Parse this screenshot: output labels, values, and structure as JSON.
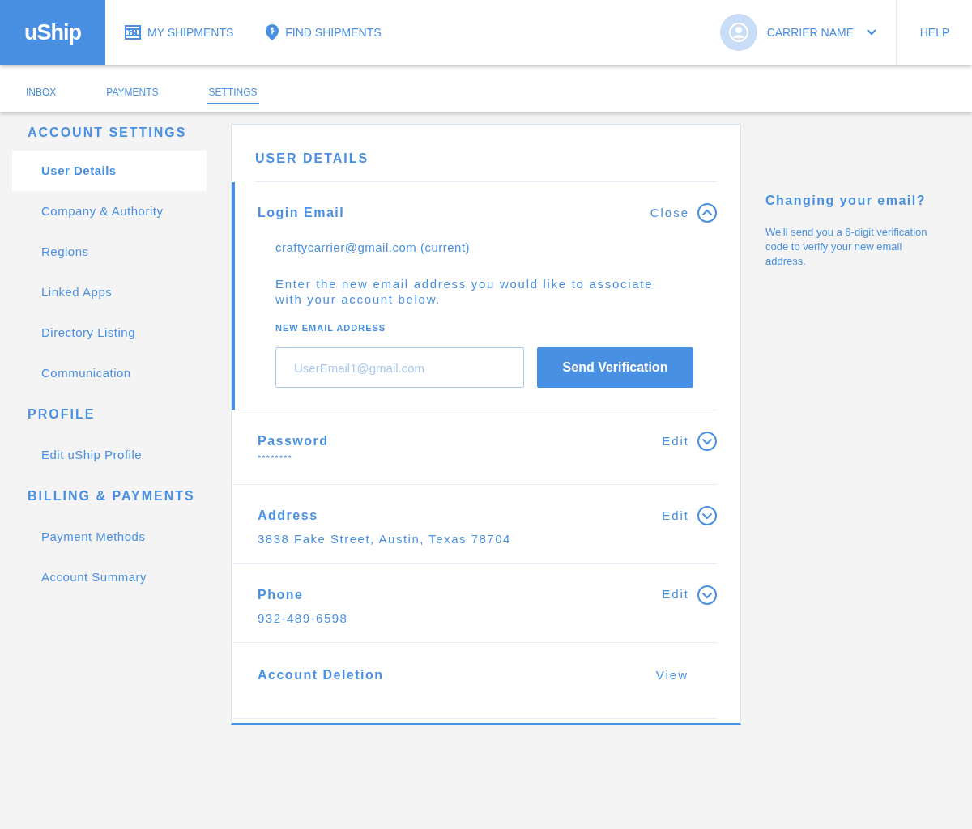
{
  "header": {
    "logo": "uShip",
    "nav": [
      {
        "label": "MY SHIPMENTS",
        "kind": "crate"
      },
      {
        "label": "FIND SHIPMENTS",
        "kind": "pin"
      }
    ],
    "user": "CARRIER NAME",
    "help": "HELP"
  },
  "subnav": [
    {
      "label": "INBOX",
      "selected": false
    },
    {
      "label": "PAYMENTS",
      "selected": false
    },
    {
      "label": "SETTINGS",
      "selected": true
    }
  ],
  "sidebar": [
    {
      "heading": "ACCOUNT SETTINGS",
      "items": [
        {
          "label": "User Details",
          "selected": true
        },
        {
          "label": "Company & Authority",
          "selected": false
        },
        {
          "label": "Regions",
          "selected": false
        },
        {
          "label": "Linked Apps",
          "selected": false
        },
        {
          "label": "Directory Listing",
          "selected": false
        },
        {
          "label": "Communication",
          "selected": false
        }
      ]
    },
    {
      "heading": "PROFILE",
      "items": [
        {
          "label": "Edit uShip Profile",
          "selected": false
        }
      ]
    },
    {
      "heading": "BILLING & PAYMENTS",
      "items": [
        {
          "label": "Payment Methods",
          "selected": false
        },
        {
          "label": "Account Summary",
          "selected": false
        }
      ]
    }
  ],
  "panel": {
    "title": "USER DETAILS",
    "sections": [
      {
        "kind": "toggle",
        "label": "Login Email",
        "action": "Close",
        "expanded": true,
        "current": "craftycarrier@gmail.com (current)",
        "instructions": "Enter the new email address you would like to associate with your account below.",
        "field_label": "NEW EMAIL ADDRESS",
        "placeholder": "UserEmail1@gmail.com",
        "button": "Send Verification"
      },
      {
        "kind": "toggle",
        "label": "Password",
        "action": "Edit",
        "expanded": false,
        "value": "********"
      },
      {
        "kind": "toggle",
        "label": "Address",
        "action": "Edit",
        "expanded": false,
        "value": "3838 Fake Street, Austin, Texas 78704"
      },
      {
        "kind": "toggle",
        "label": "Phone",
        "action": "Edit",
        "expanded": false,
        "value": "932-489-6598"
      },
      {
        "kind": "link",
        "label": "Account Deletion",
        "action": "View",
        "expanded": false
      }
    ]
  },
  "aside": {
    "title": "Changing your email?",
    "text": "We'll send you a 6-digit verification code to verify your new email address."
  }
}
